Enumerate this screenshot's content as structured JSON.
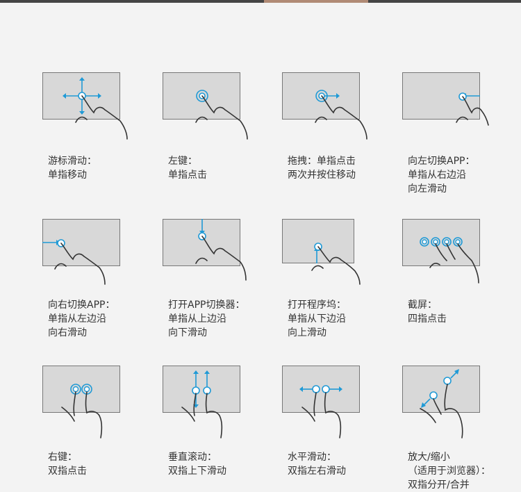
{
  "gestures": [
    {
      "id": "g1",
      "lines": [
        "游标滑动：",
        "单指移动"
      ]
    },
    {
      "id": "g2",
      "lines": [
        "左键：",
        "单指点击"
      ]
    },
    {
      "id": "g3",
      "lines": [
        "拖拽：单指点击",
        "两次并按住移动"
      ]
    },
    {
      "id": "g4",
      "lines": [
        "向左切换APP：",
        "单指从右边沿",
        "向左滑动"
      ]
    },
    {
      "id": "g5",
      "lines": [
        "向右切换APP：",
        "单指从左边沿",
        "向右滑动"
      ]
    },
    {
      "id": "g6",
      "lines": [
        "打开APP切换器：",
        "单指从上边沿",
        "向下滑动"
      ]
    },
    {
      "id": "g7",
      "lines": [
        "打开程序坞：",
        "单指从下边沿",
        "向上滑动"
      ]
    },
    {
      "id": "g8",
      "lines": [
        "截屏：",
        "四指点击"
      ]
    },
    {
      "id": "g9",
      "lines": [
        "右键：",
        "双指点击"
      ]
    },
    {
      "id": "g10",
      "lines": [
        "垂直滚动：",
        "双指上下滑动"
      ]
    },
    {
      "id": "g11",
      "lines": [
        "水平滑动：",
        "双指左右滑动"
      ]
    },
    {
      "id": "g12",
      "lines": [
        "放大/缩小",
        "（适用于浏览器）：",
        "双指分开/合并"
      ]
    }
  ],
  "colors": {
    "accent": "#1f9ad6",
    "pad": "#d8d8d8",
    "hand": "#333333"
  }
}
